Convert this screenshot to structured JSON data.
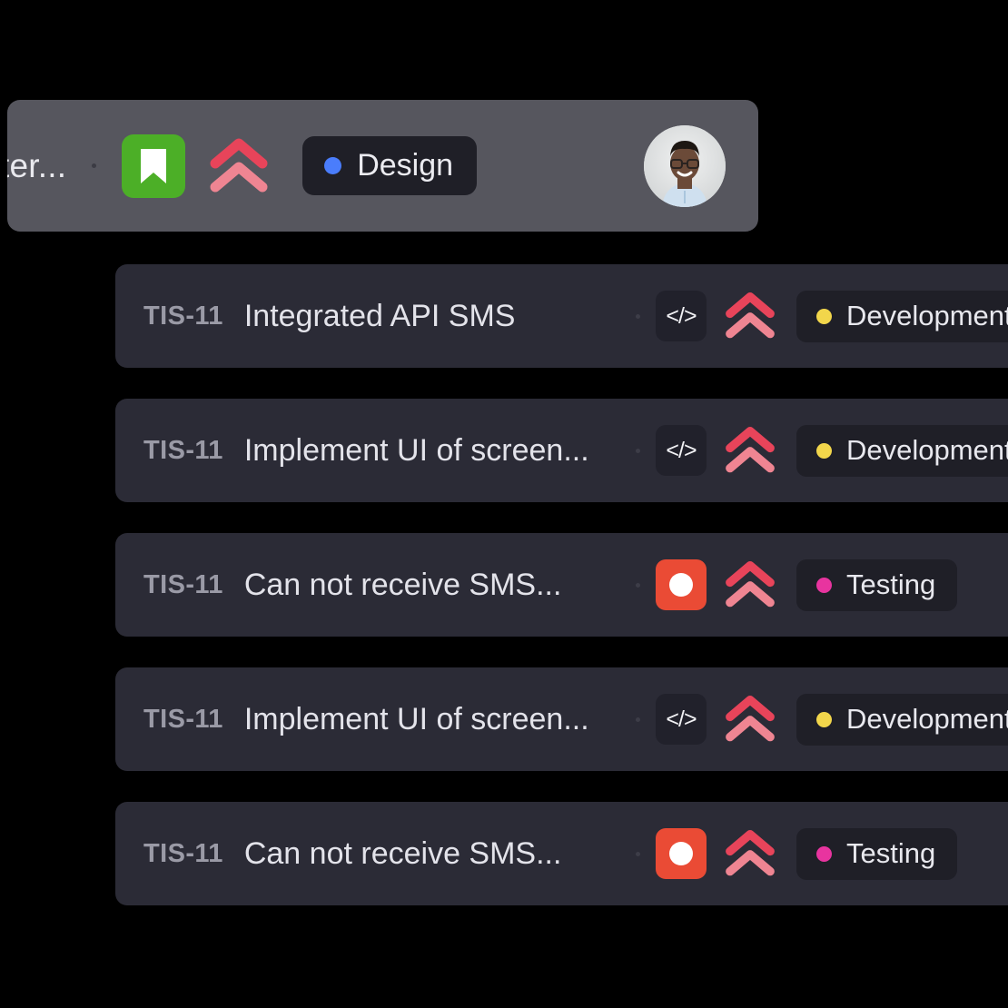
{
  "colors": {
    "page_background": "#000000",
    "header_panel_background": "#56565e",
    "row_background": "#2b2b36",
    "pill_background": "#1f1f27",
    "story_green": "#4caf27",
    "bug_red": "#ea4b35",
    "task_badge_dark": "#21212b",
    "priority_top_chevron": "#e8445a",
    "priority_bottom_chevron": "#ef8592",
    "status_design_dot": "#4a7dfc",
    "status_development_dot": "#f2d64b",
    "status_testing_dot": "#e8349f",
    "key_text": "#9a9aa6",
    "title_text": "#e3e3ea"
  },
  "header": {
    "title": "ter...",
    "type_icon": "bookmark-icon",
    "priority_icon": "priority-highest-double-chevron-icon",
    "status": {
      "label": "Design",
      "dot_color": "#4a7dfc"
    },
    "avatar": "user-avatar"
  },
  "task_list": {
    "rows": [
      {
        "key": "TIS-11",
        "title": "Integrated API SMS",
        "type_icon": "code-task-icon",
        "type_kind": "task",
        "priority_icon": "priority-highest-double-chevron-icon",
        "status": {
          "label": "Development",
          "dot_color": "#f2d64b"
        }
      },
      {
        "key": "TIS-11",
        "title": "Implement UI of screen...",
        "type_icon": "code-task-icon",
        "type_kind": "task",
        "priority_icon": "priority-highest-double-chevron-icon",
        "status": {
          "label": "Development",
          "dot_color": "#f2d64b"
        }
      },
      {
        "key": "TIS-11",
        "title": "Can not receive SMS...",
        "type_icon": "bug-icon",
        "type_kind": "bug",
        "priority_icon": "priority-highest-double-chevron-icon",
        "status": {
          "label": "Testing",
          "dot_color": "#e8349f"
        }
      },
      {
        "key": "TIS-11",
        "title": "Implement UI of screen...",
        "type_icon": "code-task-icon",
        "type_kind": "task",
        "priority_icon": "priority-highest-double-chevron-icon",
        "status": {
          "label": "Development",
          "dot_color": "#f2d64b"
        }
      },
      {
        "key": "TIS-11",
        "title": "Can not receive SMS...",
        "type_icon": "bug-icon",
        "type_kind": "bug",
        "priority_icon": "priority-highest-double-chevron-icon",
        "status": {
          "label": "Testing",
          "dot_color": "#e8349f"
        }
      }
    ]
  }
}
